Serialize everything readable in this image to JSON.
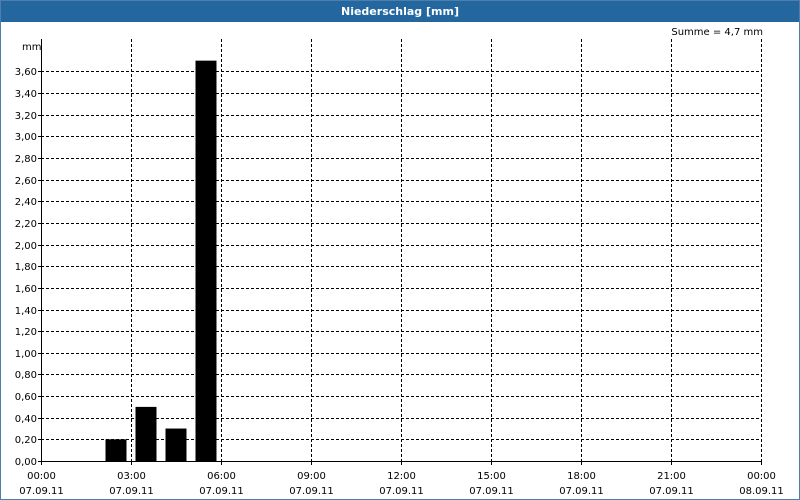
{
  "window": {
    "title": "Niederschlag [mm]"
  },
  "summary": {
    "text": "Summe = 4,7 mm"
  },
  "colors": {
    "title_bar": "#24679f",
    "bar": "#000000",
    "grid": "#000000"
  },
  "chart_data": {
    "type": "bar",
    "title": "Niederschlag [mm]",
    "unit_label": "mm",
    "ylim": [
      0,
      3.9
    ],
    "y_ticks": [
      0,
      0.2,
      0.4,
      0.6,
      0.8,
      1.0,
      1.2,
      1.4,
      1.6,
      1.8,
      2.0,
      2.2,
      2.4,
      2.6,
      2.8,
      3.0,
      3.2,
      3.4,
      3.6
    ],
    "y_tick_labels": [
      "0,00",
      "0,20",
      "0,40",
      "0,60",
      "0,80",
      "1,00",
      "1,20",
      "1,40",
      "1,60",
      "1,80",
      "2,00",
      "2,20",
      "2,40",
      "2,60",
      "2,80",
      "3,00",
      "3,20",
      "3,40",
      "3,60"
    ],
    "x_range_hours": [
      0,
      24
    ],
    "x_ticks": [
      {
        "hour": 0,
        "time": "00:00",
        "date": "07.09.11"
      },
      {
        "hour": 3,
        "time": "03:00",
        "date": "07.09.11"
      },
      {
        "hour": 6,
        "time": "06:00",
        "date": "07.09.11"
      },
      {
        "hour": 9,
        "time": "09:00",
        "date": "07.09.11"
      },
      {
        "hour": 12,
        "time": "12:00",
        "date": "07.09.11"
      },
      {
        "hour": 15,
        "time": "15:00",
        "date": "07.09.11"
      },
      {
        "hour": 18,
        "time": "18:00",
        "date": "07.09.11"
      },
      {
        "hour": 21,
        "time": "21:00",
        "date": "07.09.11"
      },
      {
        "hour": 24,
        "time": "00:00",
        "date": "08.09.11"
      }
    ],
    "bars": [
      {
        "start_hour": 2,
        "end_hour": 3,
        "value": 0.2
      },
      {
        "start_hour": 3,
        "end_hour": 4,
        "value": 0.5
      },
      {
        "start_hour": 4,
        "end_hour": 5,
        "value": 0.3
      },
      {
        "start_hour": 5,
        "end_hour": 6,
        "value": 3.7
      }
    ],
    "grid": true,
    "legend": "none"
  }
}
